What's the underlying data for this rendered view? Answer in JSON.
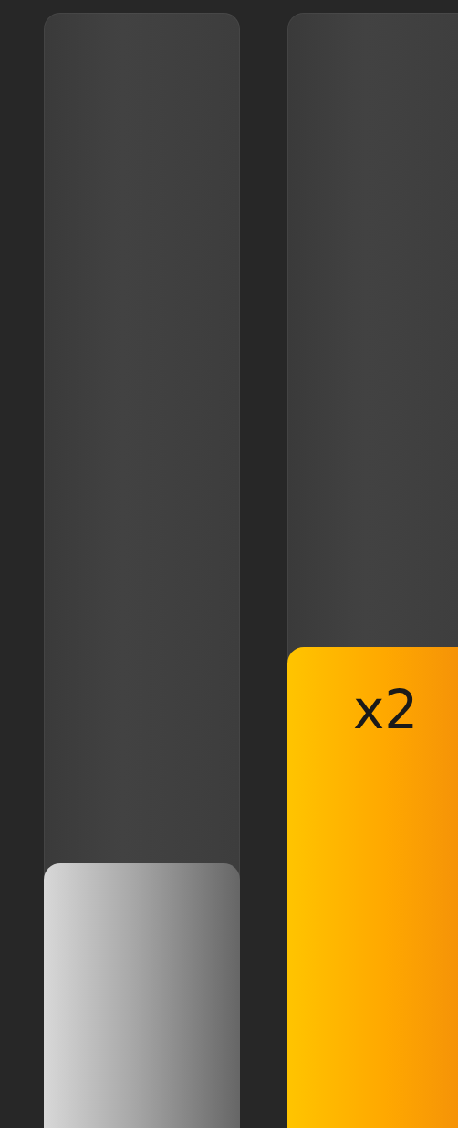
{
  "sliders": [
    {
      "kind": "plain",
      "level": 0.237
    },
    {
      "kind": "multiplier",
      "level": 0.431,
      "label": "x2"
    }
  ]
}
